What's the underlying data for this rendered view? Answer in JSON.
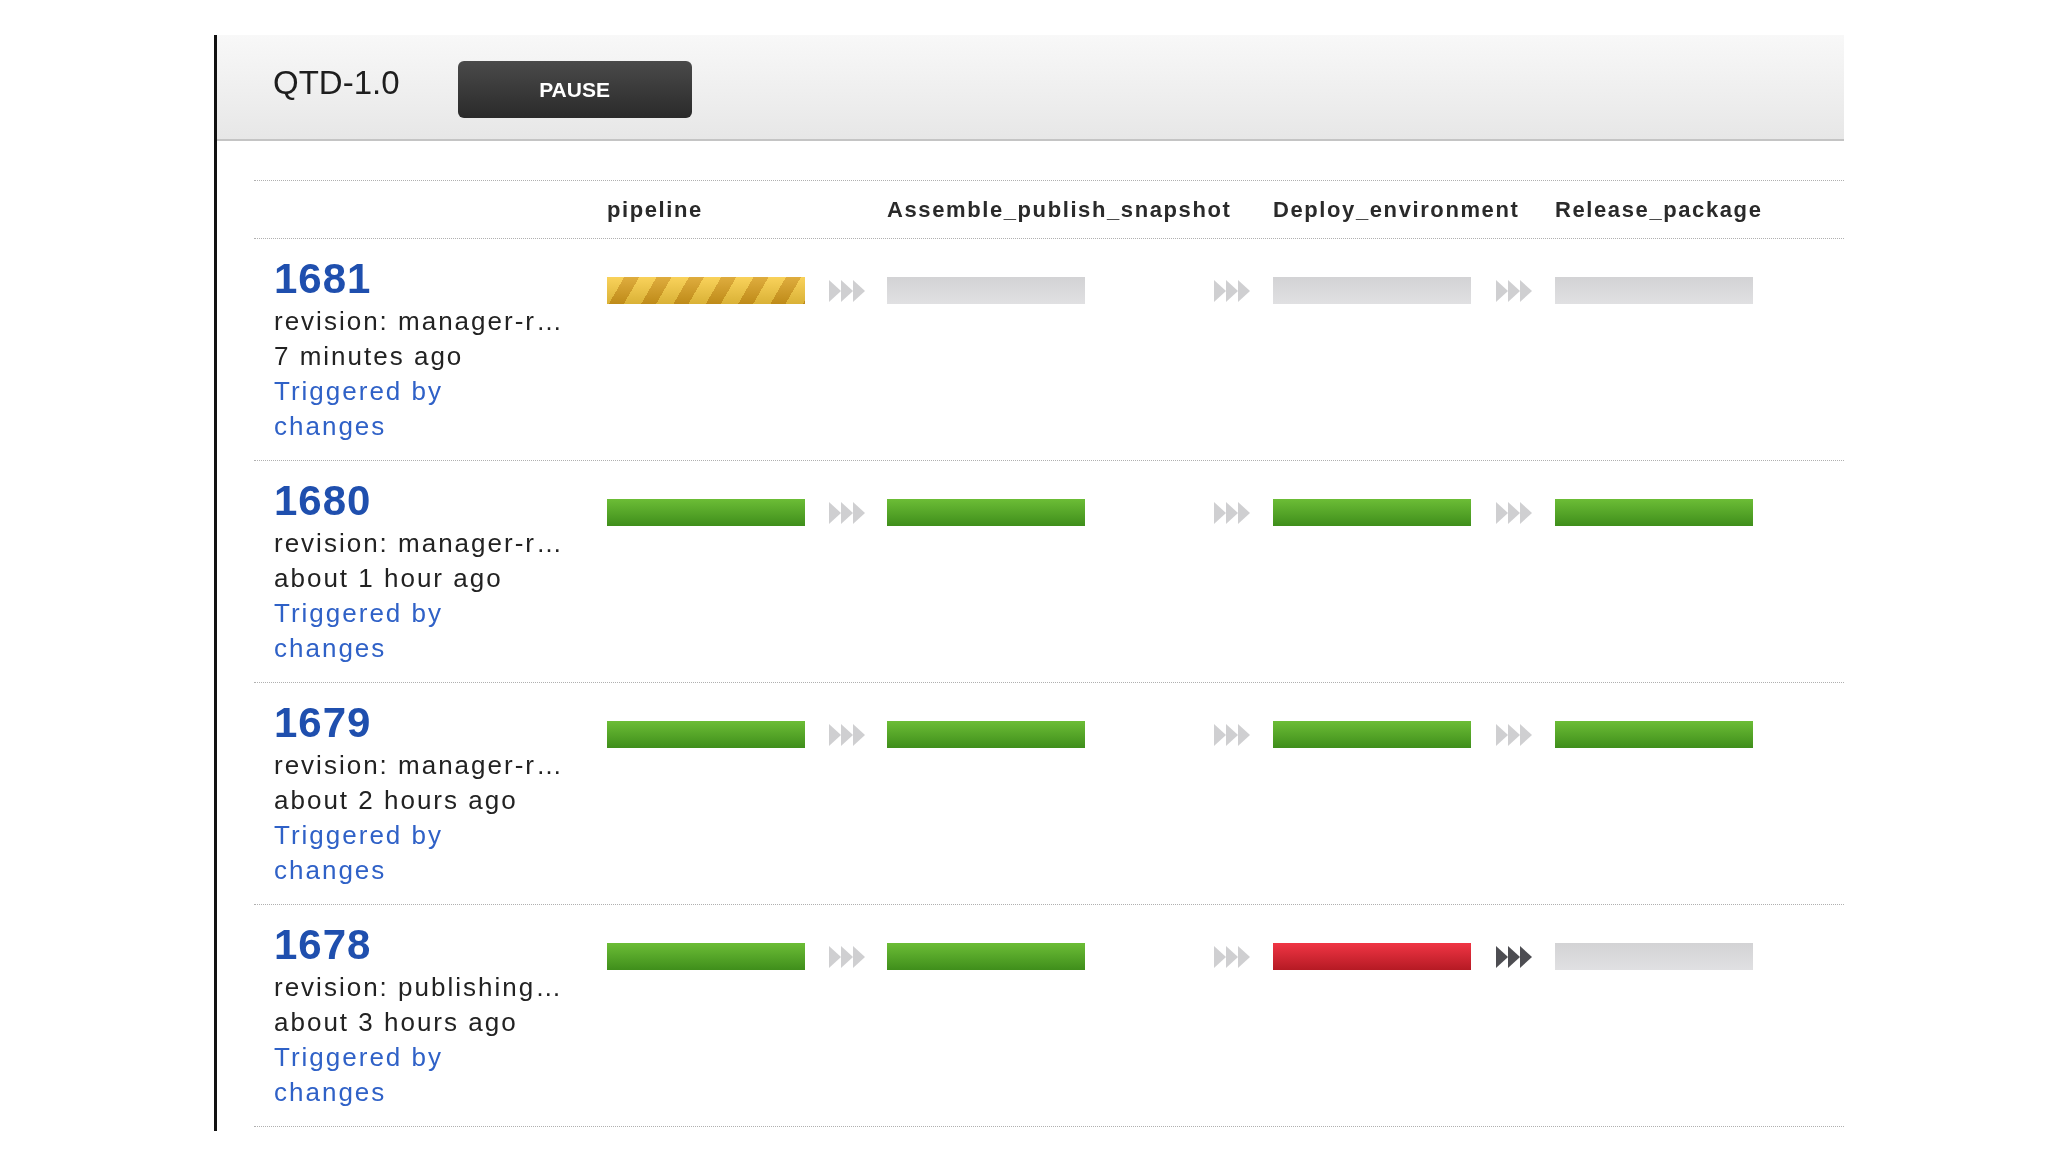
{
  "pipeline_header": {
    "title": "QTD-1.0",
    "pause_button": "PAUSE"
  },
  "stage_columns": [
    "pipeline",
    "Assemble_publish_snapshot",
    "Deploy_environment",
    "Release_package"
  ],
  "runs": [
    {
      "label": "1681",
      "revision": "revision: manager-r…",
      "time": "7 minutes ago",
      "trigger": "Triggered by changes",
      "stages": [
        {
          "kind": "building"
        },
        {
          "kind": "idle"
        },
        {
          "kind": "idle"
        },
        {
          "kind": "idle"
        }
      ],
      "transitions": [
        {
          "highlighted": false
        },
        {
          "highlighted": false
        },
        {
          "highlighted": false
        }
      ]
    },
    {
      "label": "1680",
      "revision": "revision: manager-r…",
      "time": "about 1 hour ago",
      "trigger": "Triggered by changes",
      "stages": [
        {
          "kind": "passed"
        },
        {
          "kind": "passed"
        },
        {
          "kind": "passed"
        },
        {
          "kind": "passed"
        }
      ],
      "transitions": [
        {
          "highlighted": false
        },
        {
          "highlighted": false
        },
        {
          "highlighted": false
        }
      ]
    },
    {
      "label": "1679",
      "revision": "revision: manager-r…",
      "time": "about 2 hours ago",
      "trigger": "Triggered by changes",
      "stages": [
        {
          "kind": "passed"
        },
        {
          "kind": "passed"
        },
        {
          "kind": "passed"
        },
        {
          "kind": "passed"
        }
      ],
      "transitions": [
        {
          "highlighted": false
        },
        {
          "highlighted": false
        },
        {
          "highlighted": false
        }
      ]
    },
    {
      "label": "1678",
      "revision": "revision: publishing…",
      "time": "about 3 hours ago",
      "trigger": "Triggered by changes",
      "stages": [
        {
          "kind": "passed"
        },
        {
          "kind": "passed"
        },
        {
          "kind": "failed"
        },
        {
          "kind": "idle"
        }
      ],
      "transitions": [
        {
          "highlighted": false
        },
        {
          "highlighted": false
        },
        {
          "highlighted": true
        }
      ]
    }
  ]
}
